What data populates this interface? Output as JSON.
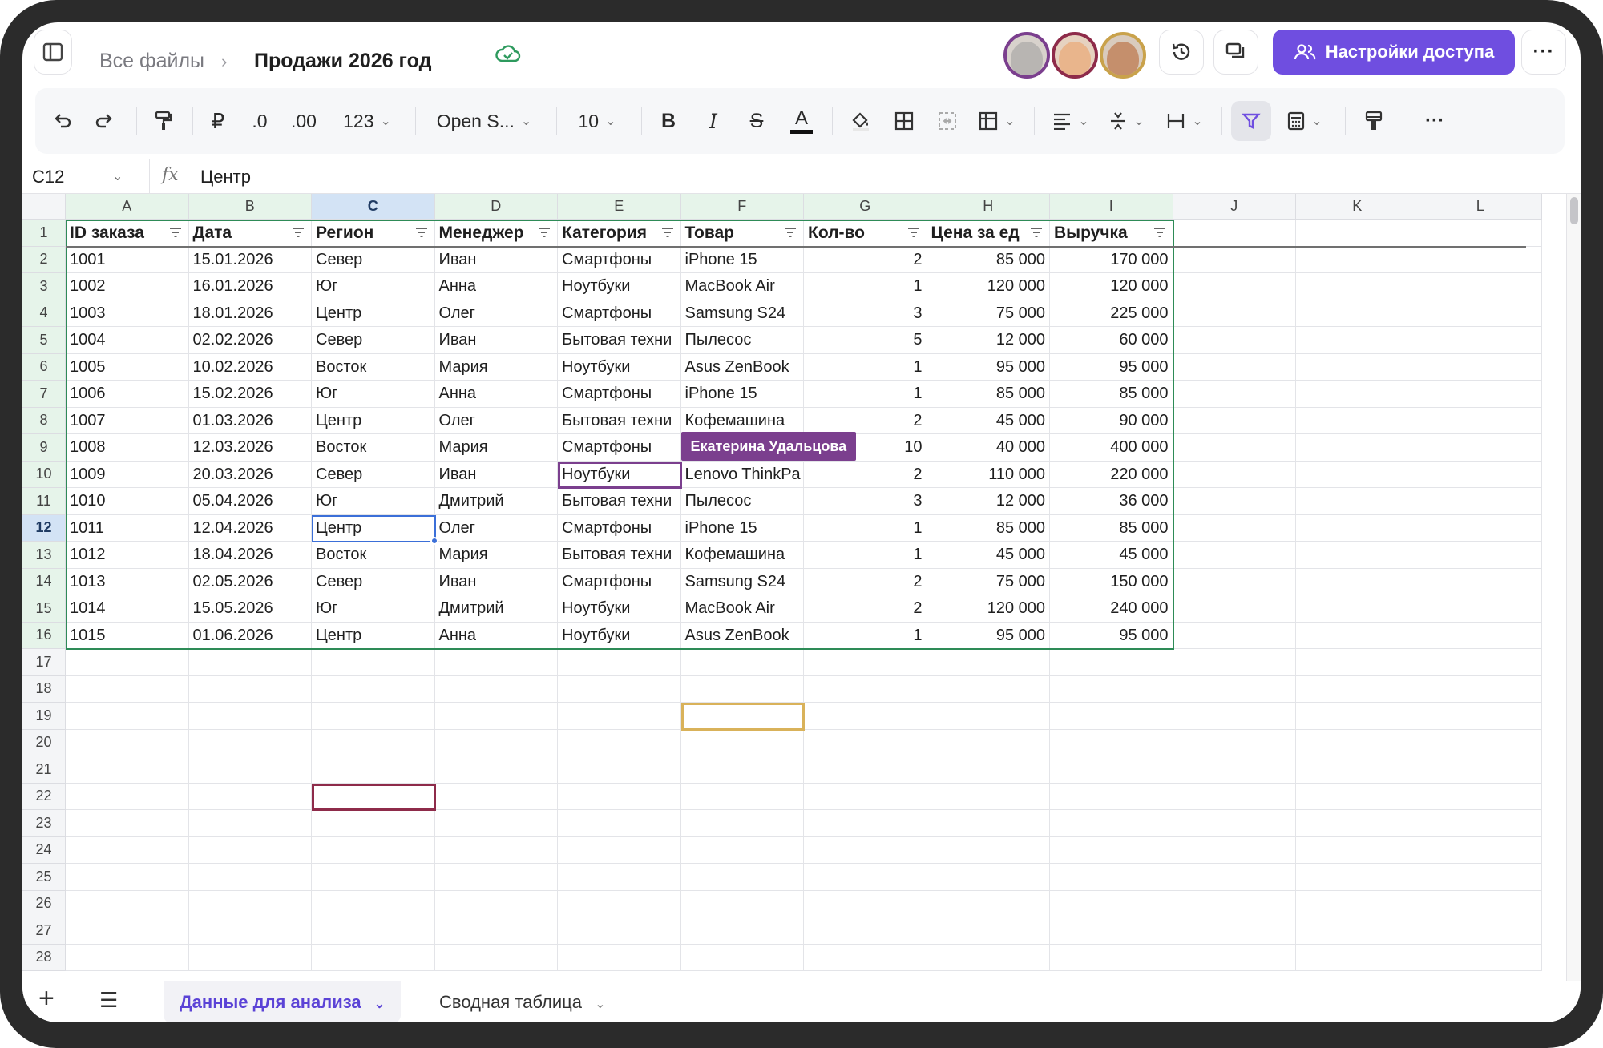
{
  "header": {
    "breadcrumb_root": "Все файлы",
    "breadcrumb_separator": "›",
    "document_title": "Продажи 2026 год",
    "share_button_label": "Настройки доступа",
    "icons": [
      "sidebar-toggle-icon",
      "cloud-saved-icon",
      "history-icon",
      "comments-icon",
      "more-icon"
    ]
  },
  "collaborators": [
    {
      "name": "avatar-1",
      "border_color": "#7b3f8e"
    },
    {
      "name": "avatar-2",
      "border_color": "#8e2b4a"
    },
    {
      "name": "avatar-3",
      "border_color": "#c9a24b"
    }
  ],
  "toolbar": {
    "decimal_decrease": ".0",
    "decimal_increase": ".00",
    "number_format": "123",
    "font_family": "Open S...",
    "font_size": "10",
    "currency_symbol": "₽"
  },
  "formula_bar": {
    "cell_ref": "C12",
    "fx_label": "fx",
    "value": "Центр"
  },
  "columns": [
    "A",
    "B",
    "C",
    "D",
    "E",
    "F",
    "G",
    "H",
    "I",
    "J",
    "K",
    "L"
  ],
  "rows": [
    "1",
    "2",
    "3",
    "4",
    "5",
    "6",
    "7",
    "8",
    "9",
    "10",
    "11",
    "12",
    "13",
    "14",
    "15",
    "16",
    "17",
    "18",
    "19",
    "20",
    "21",
    "22",
    "23",
    "24",
    "25",
    "26",
    "27",
    "28"
  ],
  "table": {
    "headers": [
      "ID заказа",
      "Дата",
      "Регион",
      "Менеджер",
      "Категория",
      "Товар",
      "Кол-во",
      "Цена за ед",
      "Выручка"
    ],
    "rows": [
      [
        "1001",
        "15.01.2026",
        "Север",
        "Иван",
        "Смартфоны",
        "iPhone 15",
        "2",
        "85 000",
        "170 000"
      ],
      [
        "1002",
        "16.01.2026",
        "Юг",
        "Анна",
        "Ноутбуки",
        "MacBook Air",
        "1",
        "120 000",
        "120 000"
      ],
      [
        "1003",
        "18.01.2026",
        "Центр",
        "Олег",
        "Смартфоны",
        "Samsung S24",
        "3",
        "75 000",
        "225 000"
      ],
      [
        "1004",
        "02.02.2026",
        "Север",
        "Иван",
        "Бытовая техни",
        "Пылесос",
        "5",
        "12 000",
        "60 000"
      ],
      [
        "1005",
        "10.02.2026",
        "Восток",
        "Мария",
        "Ноутбуки",
        "Asus ZenBook",
        "1",
        "95 000",
        "95 000"
      ],
      [
        "1006",
        "15.02.2026",
        "Юг",
        "Анна",
        "Смартфоны",
        "iPhone 15",
        "1",
        "85 000",
        "85 000"
      ],
      [
        "1007",
        "01.03.2026",
        "Центр",
        "Олег",
        "Бытовая техни",
        "Кофемашина",
        "2",
        "45 000",
        "90 000"
      ],
      [
        "1008",
        "12.03.2026",
        "Восток",
        "Мария",
        "Смартфоны",
        "",
        "10",
        "40 000",
        "400 000"
      ],
      [
        "1009",
        "20.03.2026",
        "Север",
        "Иван",
        "Ноутбуки",
        "Lenovo ThinkPa",
        "2",
        "110 000",
        "220 000"
      ],
      [
        "1010",
        "05.04.2026",
        "Юг",
        "Дмитрий",
        "Бытовая техни",
        "Пылесос",
        "3",
        "12 000",
        "36 000"
      ],
      [
        "1011",
        "12.04.2026",
        "Центр",
        "Олег",
        "Смартфоны",
        "iPhone 15",
        "1",
        "85 000",
        "85 000"
      ],
      [
        "1012",
        "18.04.2026",
        "Восток",
        "Мария",
        "Бытовая техни",
        "Кофемашина",
        "1",
        "45 000",
        "45 000"
      ],
      [
        "1013",
        "02.05.2026",
        "Север",
        "Иван",
        "Смартфоны",
        "Samsung S24",
        "2",
        "75 000",
        "150 000"
      ],
      [
        "1014",
        "15.05.2026",
        "Юг",
        "Дмитрий",
        "Ноутбуки",
        "MacBook Air",
        "2",
        "120 000",
        "240 000"
      ],
      [
        "1015",
        "01.06.2026",
        "Центр",
        "Анна",
        "Ноутбуки",
        "Asus ZenBook",
        "1",
        "95 000",
        "95 000"
      ]
    ],
    "numeric_columns": [
      6,
      7,
      8
    ]
  },
  "collab_label": "Екатерина Удальцова",
  "sheets": {
    "active": "Данные для анализа",
    "other": "Сводная таблица"
  },
  "colors": {
    "accent": "#6f4ee0",
    "range_border": "#2e8b57",
    "active_cell": "#3b6fd8",
    "collab_purple": "#7b3f8e",
    "collab_gold": "#d9b25a",
    "collab_maroon": "#8e2b4a"
  }
}
